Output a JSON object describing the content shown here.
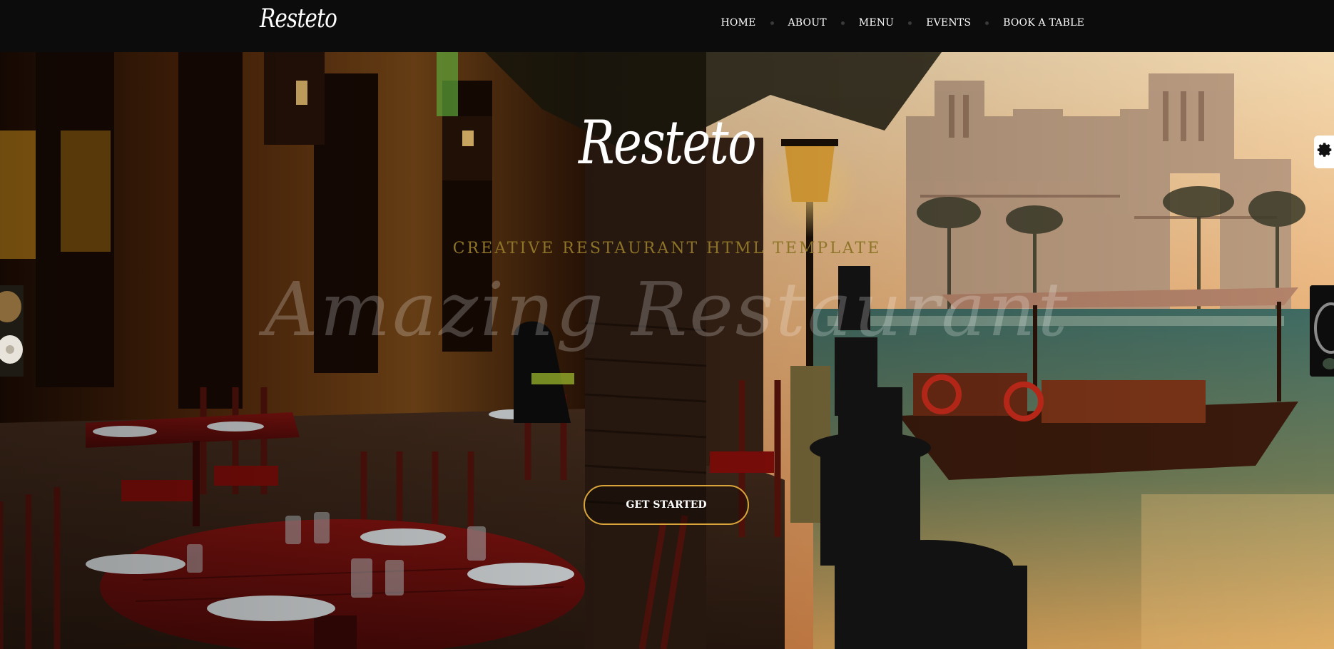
{
  "brand": {
    "logo": "Resteto"
  },
  "nav": {
    "items": [
      {
        "label": "HOME"
      },
      {
        "label": "ABOUT"
      },
      {
        "label": "MENU"
      },
      {
        "label": "EVENTS"
      },
      {
        "label": "BOOK A TABLE"
      }
    ]
  },
  "hero": {
    "title": "Resteto",
    "tagline": "CREATIVE RESTAURANT HTML TEMPLATE",
    "watermark": "Amazing Restaurant",
    "cta_label": "GET STARTED"
  },
  "colors": {
    "accent": "#d9a43a",
    "tagline": "#8d7428",
    "navbar": "#0c0c0c"
  },
  "icons": {
    "settings": "gear-icon"
  }
}
